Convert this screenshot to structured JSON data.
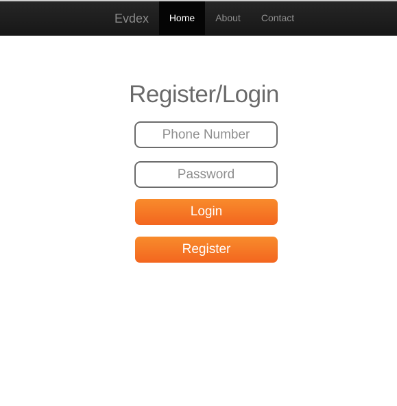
{
  "navbar": {
    "brand": "Evdex",
    "items": [
      {
        "label": "Home",
        "active": true
      },
      {
        "label": "About",
        "active": false
      },
      {
        "label": "Contact",
        "active": false
      }
    ]
  },
  "form": {
    "title": "Register/Login",
    "phone_placeholder": "Phone Number",
    "password_placeholder": "Password",
    "login_label": "Login",
    "register_label": "Register"
  },
  "colors": {
    "navbar_background": "#1f1f1f",
    "active_tab_background": "#050505",
    "button_accent": "#f47a25",
    "title_text": "#6a6a6a",
    "field_border": "#6b6b6b"
  }
}
